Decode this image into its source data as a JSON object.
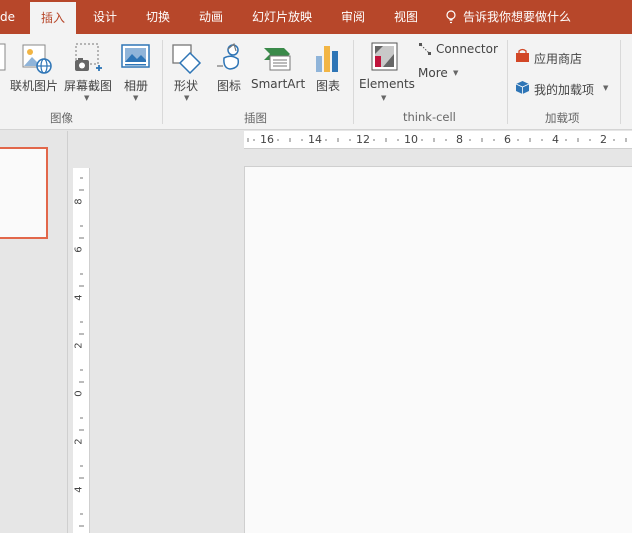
{
  "tabs": [
    {
      "label": "de",
      "active": false
    },
    {
      "label": "插入",
      "active": true
    },
    {
      "label": "设计",
      "active": false
    },
    {
      "label": "切换",
      "active": false
    },
    {
      "label": "动画",
      "active": false
    },
    {
      "label": "幻灯片放映",
      "active": false
    },
    {
      "label": "审阅",
      "active": false
    },
    {
      "label": "视图",
      "active": false
    }
  ],
  "tell_me": {
    "placeholder": "告诉我你想要做什么"
  },
  "ribbon": {
    "images_group": {
      "label": "图像",
      "online_pictures": "联机图片",
      "screenshot": "屏幕截图",
      "photo_album": "相册"
    },
    "illustrations_group": {
      "label": "插图",
      "shapes": "形状",
      "icons": "图标",
      "smartart": "SmartArt",
      "chart": "图表"
    },
    "thinkcell_group": {
      "label": "think-cell",
      "elements": "Elements",
      "connector": "Connector",
      "more": "More"
    },
    "addins_group": {
      "label": "加载项",
      "store": "应用商店",
      "my_addins": "我的加载项"
    }
  },
  "rulers": {
    "horizontal": [
      "16",
      "14",
      "12",
      "10",
      "8",
      "6",
      "4",
      "2"
    ],
    "vertical": [
      "8",
      "6",
      "4",
      "2",
      "0",
      "2",
      "4"
    ]
  },
  "colors": {
    "accent": "#b7472a",
    "ribbon_bg": "#f3f3f3",
    "thumb_border": "#e2674a"
  }
}
